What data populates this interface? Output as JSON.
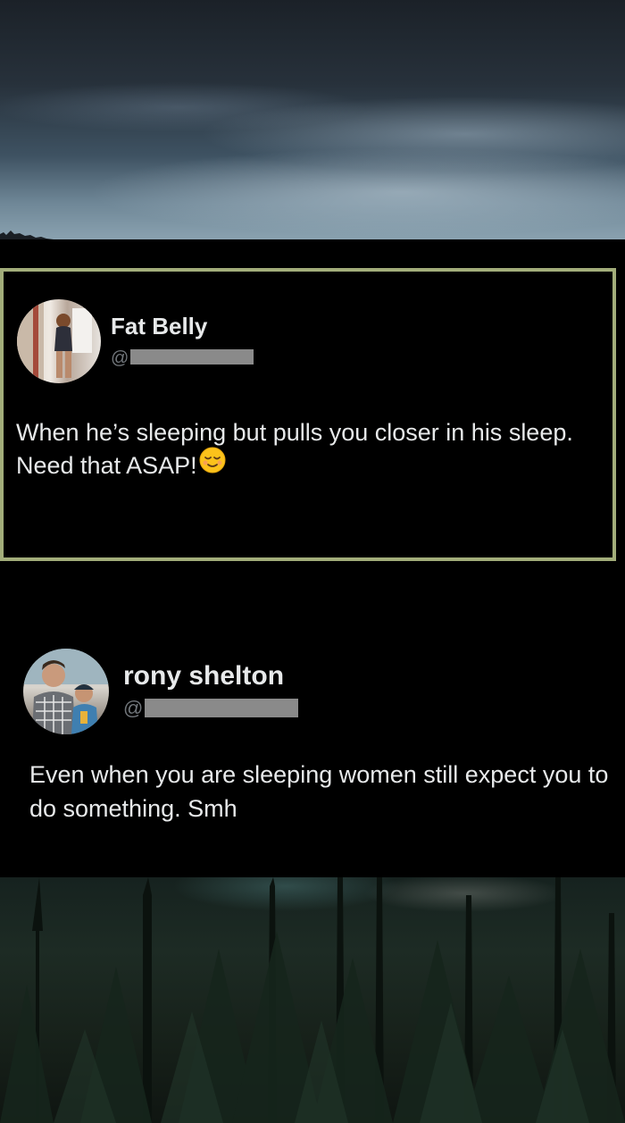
{
  "posts": [
    {
      "name": "Fat Belly",
      "handle_prefix": "@",
      "text": "When he’s sleeping but pulls you closer in his sleep. Need that ASAP!",
      "emoji": "relieved-face",
      "highlight_color": "#a2ad7a"
    },
    {
      "name": "rony shelton",
      "handle_prefix": "@",
      "text": "Even when you are sleeping women still expect you to do something. Smh"
    }
  ],
  "colors": {
    "background": "#000000",
    "text_primary": "#e7e9ea",
    "text_secondary": "#71767b",
    "redaction": "#8a8a8a"
  }
}
